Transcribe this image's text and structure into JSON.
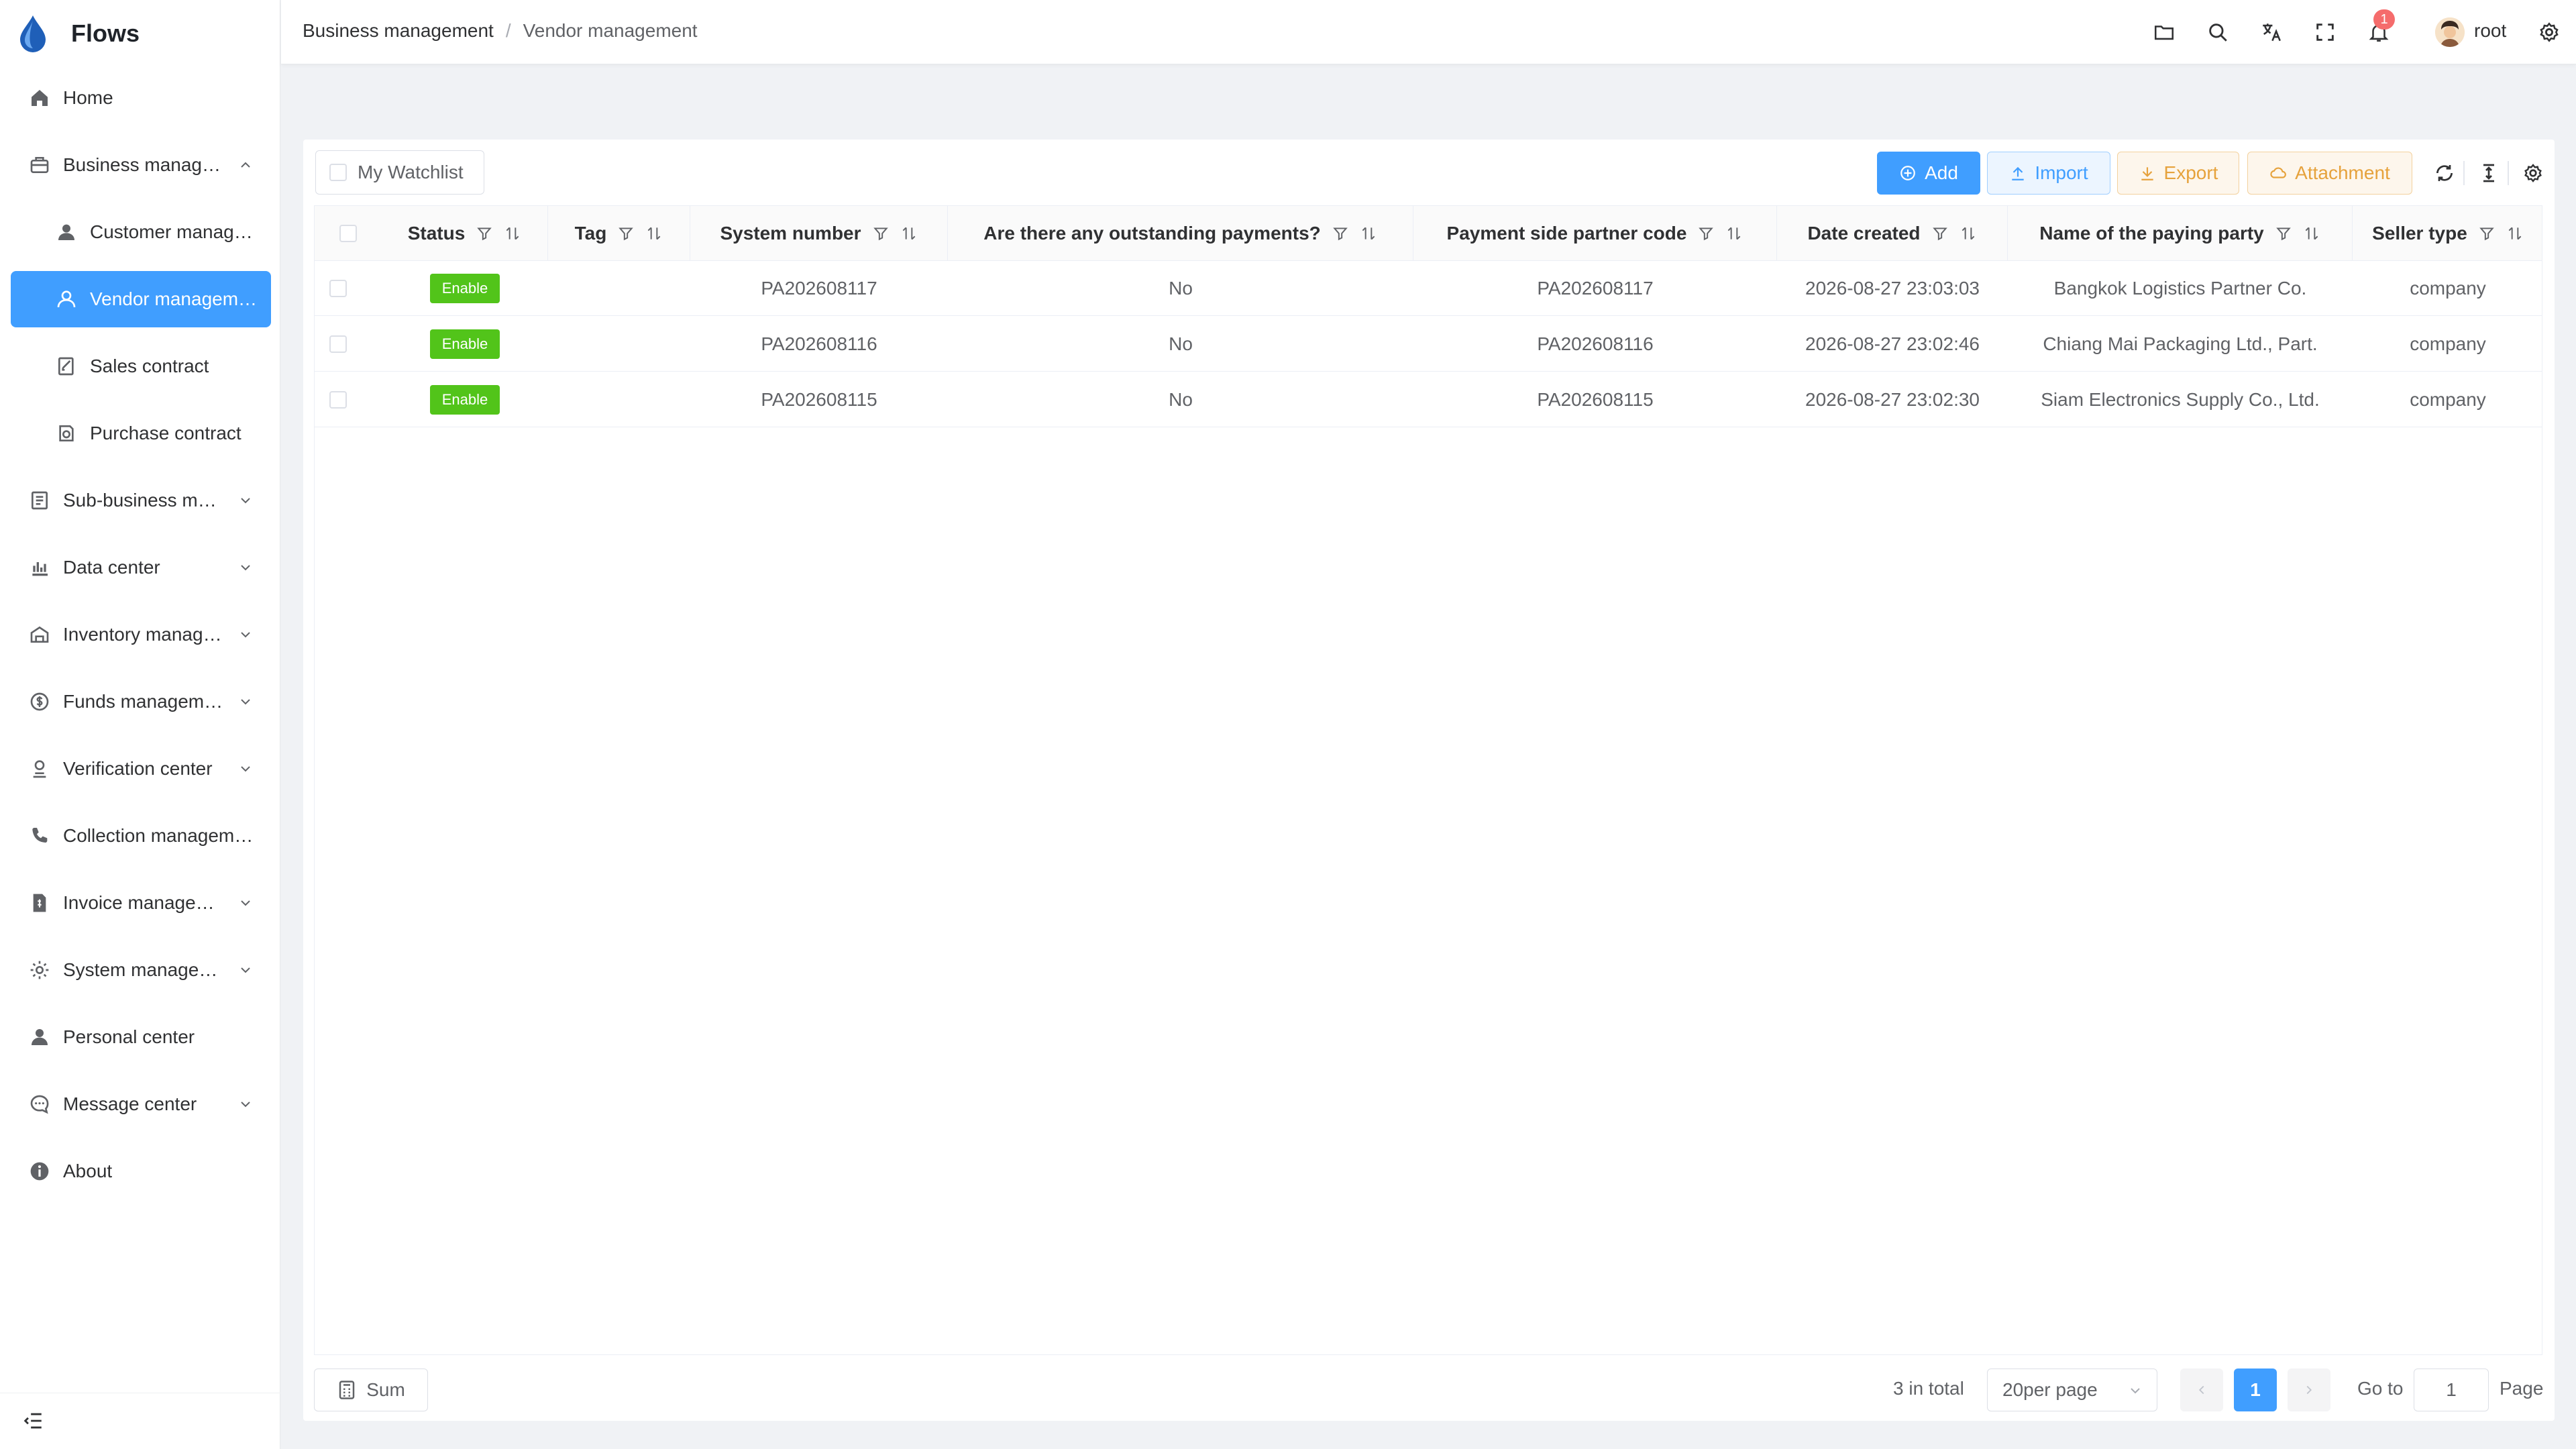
{
  "app": {
    "title": "Flows"
  },
  "sidebar": {
    "items": [
      {
        "label": "Home",
        "icon": "home-icon"
      },
      {
        "label": "Business manag…",
        "icon": "briefcase-icon",
        "expanded": true
      },
      {
        "label": "Customer manag…",
        "icon": "user-icon",
        "sub": true
      },
      {
        "label": "Vendor managem…",
        "icon": "user-outline-icon",
        "sub": true,
        "active": true
      },
      {
        "label": "Sales contract",
        "icon": "edit-doc-icon",
        "sub": true
      },
      {
        "label": "Purchase contract",
        "icon": "stamp-icon",
        "sub": true
      },
      {
        "label": "Sub-business m…",
        "icon": "docs-icon"
      },
      {
        "label": "Data center",
        "icon": "chart-icon"
      },
      {
        "label": "Inventory manag…",
        "icon": "warehouse-icon"
      },
      {
        "label": "Funds managem…",
        "icon": "coin-icon"
      },
      {
        "label": "Verification center",
        "icon": "verify-icon"
      },
      {
        "label": "Collection managem…",
        "icon": "phone-icon"
      },
      {
        "label": "Invoice manage…",
        "icon": "invoice-icon"
      },
      {
        "label": "System manage…",
        "icon": "gear-icon"
      },
      {
        "label": "Personal center",
        "icon": "person-icon"
      },
      {
        "label": "Message center",
        "icon": "chat-icon"
      },
      {
        "label": "About",
        "icon": "info-icon"
      }
    ]
  },
  "breadcrumb": {
    "parent": "Business management",
    "separator": "/",
    "current": "Vendor management"
  },
  "header": {
    "notifications": "1",
    "username": "root"
  },
  "toolbar": {
    "watchlist": "My Watchlist",
    "add": "Add",
    "import": "Import",
    "export": "Export",
    "attachment": "Attachment"
  },
  "table": {
    "columns": [
      "Status",
      "Tag",
      "System number",
      "Are there any outstanding payments?",
      "Payment side partner code",
      "Date created",
      "Name of the paying party",
      "Seller type"
    ],
    "rows": [
      {
        "status": "Enable",
        "tag": "",
        "system_number": "PA202608117",
        "outstanding": "No",
        "partner_code": "PA202608117",
        "date_created": "2026-08-27 23:03:03",
        "paying_party": "Bangkok Logistics Partner Co.",
        "seller_type": "company"
      },
      {
        "status": "Enable",
        "tag": "",
        "system_number": "PA202608116",
        "outstanding": "No",
        "partner_code": "PA202608116",
        "date_created": "2026-08-27 23:02:46",
        "paying_party": "Chiang Mai Packaging Ltd., Part.",
        "seller_type": "company"
      },
      {
        "status": "Enable",
        "tag": "",
        "system_number": "PA202608115",
        "outstanding": "No",
        "partner_code": "PA202608115",
        "date_created": "2026-08-27 23:02:30",
        "paying_party": "Siam Electronics Supply Co., Ltd.",
        "seller_type": "company"
      }
    ]
  },
  "footer": {
    "sum": "Sum",
    "total": "3 in total",
    "page_size": "20per page",
    "current_page": "1",
    "goto_label": "Go to",
    "goto_value": "1",
    "page_label": "Page"
  },
  "colors": {
    "primary": "#409eff",
    "success": "#52c41a",
    "warning": "#e6a23c",
    "danger": "#f56c6c"
  }
}
